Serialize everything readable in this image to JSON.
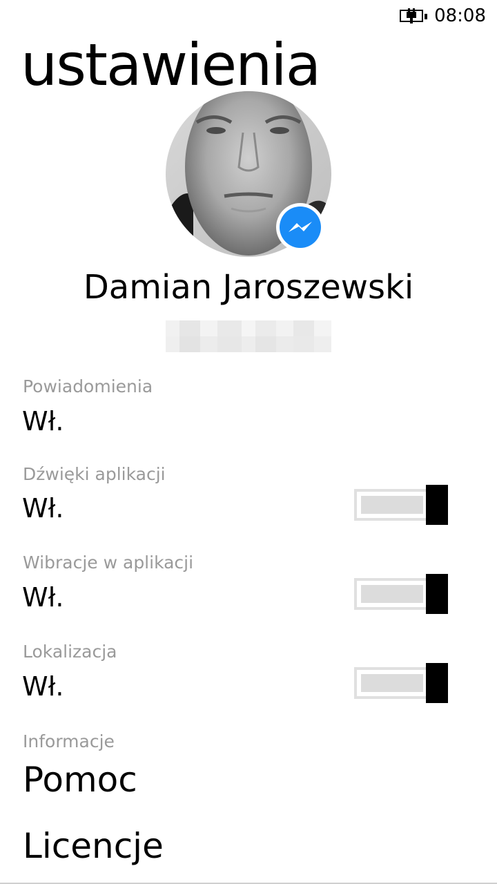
{
  "status_bar": {
    "battery_icon": "battery-charging-icon",
    "time": "08:08"
  },
  "page": {
    "title": "ustawienia"
  },
  "profile": {
    "name": "Damian Jaroszewski",
    "badge_icon": "messenger-icon",
    "badge_color": "#1a8cf7"
  },
  "settings": [
    {
      "label": "Powiadomienia",
      "value": "Wł.",
      "has_toggle": false
    },
    {
      "label": "Dźwięki aplikacji",
      "value": "Wł.",
      "has_toggle": true,
      "toggle_on": true
    },
    {
      "label": "Wibracje w aplikacji",
      "value": "Wł.",
      "has_toggle": true,
      "toggle_on": true
    },
    {
      "label": "Lokalizacja",
      "value": "Wł.",
      "has_toggle": true,
      "toggle_on": true
    }
  ],
  "info": {
    "label": "Informacje",
    "items": [
      "Pomoc",
      "Licencje"
    ]
  },
  "colors": {
    "label_gray": "#9a9a9a",
    "toggle_thumb": "#000000",
    "toggle_fill": "#dcdcdc"
  }
}
